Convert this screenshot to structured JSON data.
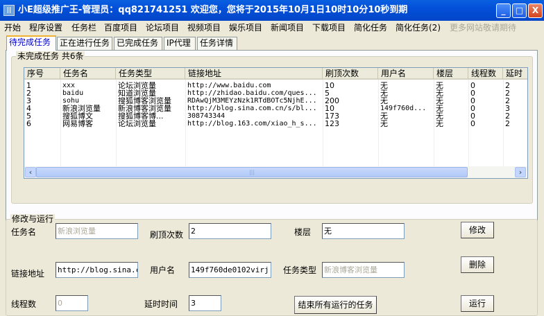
{
  "window": {
    "title": "小E超级推广王-管理员：qq821741251 欢迎您，您将于2015年10月1日10时10分10秒到期",
    "minimize": "_",
    "maximize": "□",
    "close": "X"
  },
  "menu": [
    "开始",
    "程序设置",
    "任务栏",
    "百度项目",
    "论坛项目",
    "视频项目",
    "娱乐项目",
    "新闻项目",
    "下载项目",
    "简化任务",
    "简化任务(2)",
    "更多网站敬请期待"
  ],
  "tabs": [
    "待完成任务",
    "正在进行任务",
    "已完成任务",
    "IP代理",
    "任务详情"
  ],
  "pending_group": {
    "label": "未完成任务 共6条"
  },
  "table": {
    "headers": [
      "序号",
      "任务名",
      "任务类型",
      "链接地址",
      "刷顶次数",
      "用户名",
      "楼层",
      "线程数",
      "延时"
    ],
    "rows": [
      [
        "1",
        "xxx",
        "论坛浏览量",
        "http://www.baidu.com",
        "10",
        "无",
        "无",
        "0",
        "2"
      ],
      [
        "2",
        "baidu",
        "知道浏览量",
        "http://zhidao.baidu.com/ques...",
        "5",
        "无",
        "无",
        "0",
        "2"
      ],
      [
        "3",
        "sohu",
        "搜狐博客浏览量",
        "RDAwQjM3MEYzNzk1RTdBOTc5NjhE...",
        "200",
        "无",
        "无",
        "0",
        "2"
      ],
      [
        "4",
        "新浪浏览量",
        "新浪博客浏览量",
        "http://blog.sina.com.cn/s/bl...",
        "10",
        "149f760d...",
        "无",
        "0",
        "3"
      ],
      [
        "5",
        "搜狐博文",
        "搜狐博客博...",
        "308743344",
        "173",
        "无",
        "无",
        "0",
        "2"
      ],
      [
        "6",
        "网易博客",
        "论坛浏览量",
        "http://blog.163.com/xiao_h_s...",
        "123",
        "无",
        "无",
        "0",
        "2"
      ]
    ]
  },
  "form": {
    "group_label": "修改与运行",
    "task_name_label": "任务名",
    "task_name": "新浪浏览量",
    "refresh_label": "刷顶次数",
    "refresh": "2",
    "floor_label": "楼层",
    "floor": "无",
    "url_label": "链接地址",
    "url": "http://blog.sina.com.cn",
    "user_label": "用户名",
    "user": "149f760de0102virj",
    "type_label": "任务类型",
    "type": "新浪博客浏览量",
    "threads_label": "线程数",
    "threads": "0",
    "delay_label": "延时时间",
    "delay": "3",
    "modify": "修改",
    "delete": "删除",
    "run": "运行",
    "stop_all": "结束所有运行的任务"
  }
}
